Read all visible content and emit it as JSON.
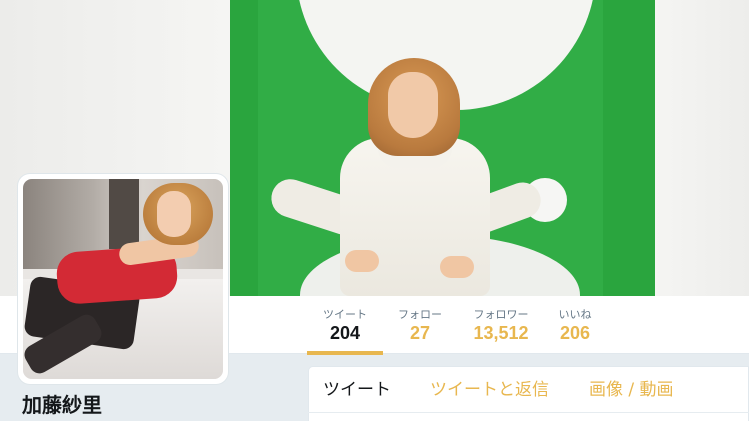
{
  "profile": {
    "name": "加藤紗里"
  },
  "nav": {
    "items": [
      {
        "label": "ツイート",
        "value": "204",
        "active": true
      },
      {
        "label": "フォロー",
        "value": "27",
        "active": false
      },
      {
        "label": "フォロワー",
        "value": "13,512",
        "active": false
      },
      {
        "label": "いいね",
        "value": "206",
        "active": false
      }
    ]
  },
  "timeline_tabs": [
    {
      "label": "ツイート",
      "active": true
    },
    {
      "label": "ツイートと返信",
      "active": false
    },
    {
      "label": "画像 / 動画",
      "active": false
    }
  ],
  "colors": {
    "accent": "#e8b74f",
    "text_primary": "#14171a",
    "text_secondary": "#657786",
    "banner_green": "#2aa53e",
    "page_background": "#e6ecf0"
  }
}
